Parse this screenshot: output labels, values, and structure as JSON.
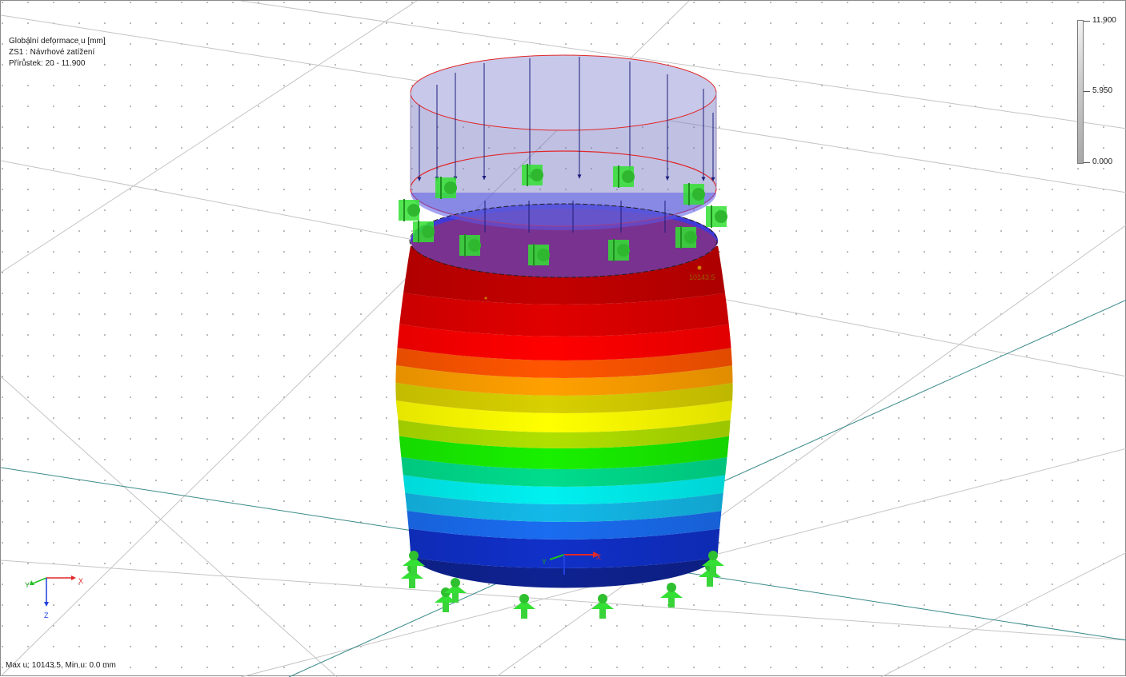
{
  "info": {
    "line1": "Globální deformace u [mm]",
    "line2": "ZS1 : Návrhové zatížení",
    "line3": "Přírůstek: 20 - 11.900"
  },
  "scale": {
    "max_label": "11.900",
    "mid_label": "5.950",
    "min_label": "0.000"
  },
  "max_marker_label": "10143.5",
  "status": "Max u: 10143.5, Min u: 0.0 mm",
  "axes": {
    "x": "X",
    "y": "Y",
    "z": "Z"
  },
  "colors": {
    "grid": "#c9c9c9",
    "axis_line": "#2f7c7c",
    "support": "#33e033",
    "load_arrow": "#1c1c7a",
    "load_area": "#8a8ac8",
    "load_outline": "#e03030",
    "bands": [
      "#0e2291",
      "#1030c8",
      "#1a6cf0",
      "#13b9e8",
      "#00f0f0",
      "#00dc8c",
      "#18f000",
      "#b0e000",
      "#ffff00",
      "#d8d000",
      "#ffa000",
      "#ff5500",
      "#ff0000",
      "#e00000",
      "#c30000"
    ]
  }
}
